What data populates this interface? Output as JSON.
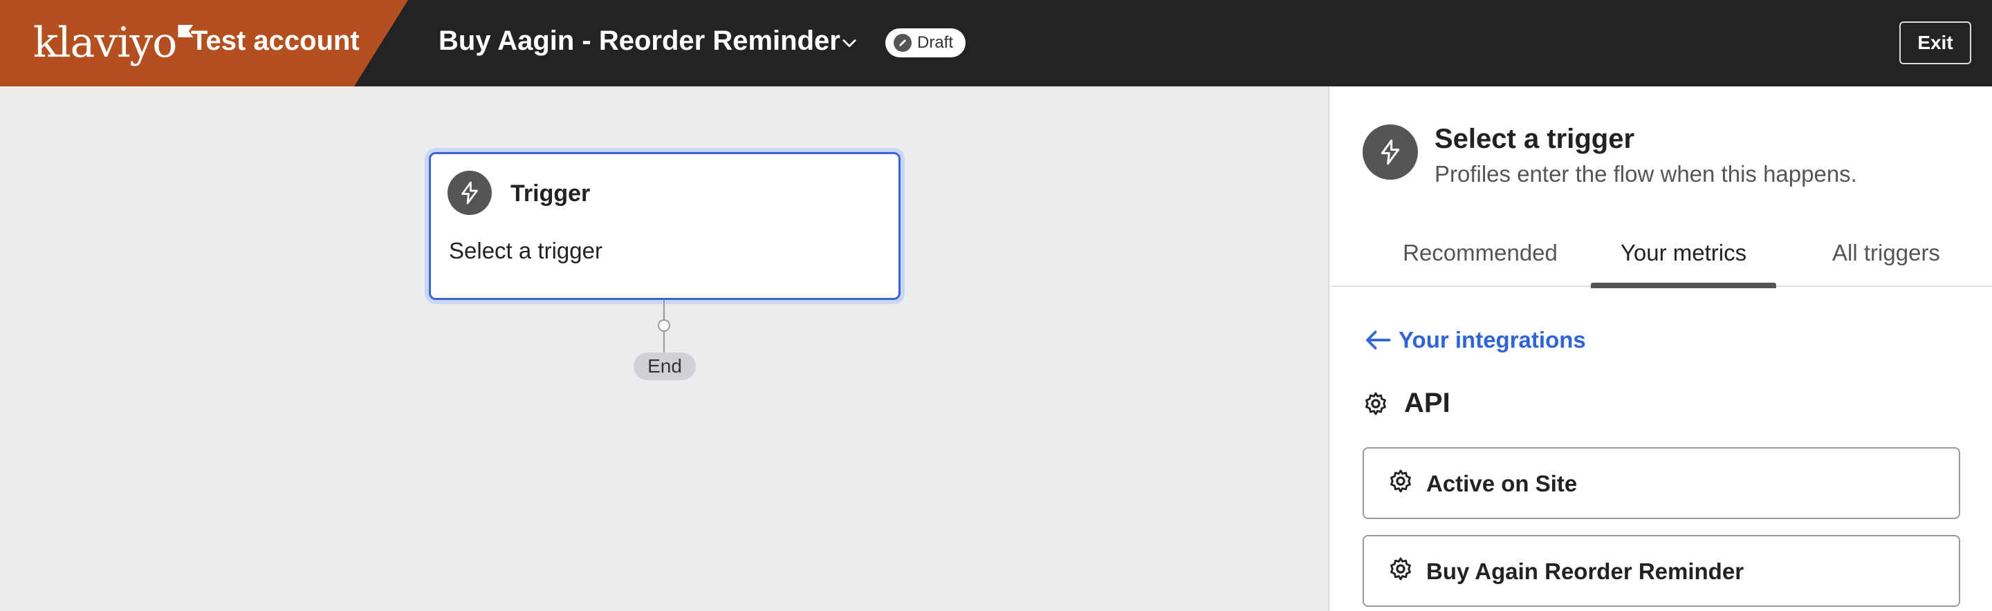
{
  "header": {
    "logo_text": "klaviyo",
    "account_name": "Test account",
    "flow_title": "Buy Aagin - Reorder Reminder",
    "status_badge": "Draft",
    "exit_label": "Exit",
    "brand_color": "#b44f1f",
    "bar_color": "#232323"
  },
  "canvas": {
    "trigger_card": {
      "title": "Trigger",
      "subtitle": "Select a trigger",
      "icon": "lightning-icon"
    },
    "end_label": "End"
  },
  "panel": {
    "title": "Select a trigger",
    "subtitle": "Profiles enter the flow when this happens.",
    "tabs": [
      {
        "label": "Recommended",
        "active": false
      },
      {
        "label": "Your metrics",
        "active": true
      },
      {
        "label": "All triggers",
        "active": false
      }
    ],
    "back_link": "Your integrations",
    "section": {
      "title": "API",
      "icon": "gear-icon",
      "metrics": [
        {
          "label": "Active on Site",
          "icon": "gear-icon"
        },
        {
          "label": "Buy Again Reorder Reminder",
          "icon": "gear-icon"
        }
      ]
    },
    "link_color": "#2f63d8"
  }
}
